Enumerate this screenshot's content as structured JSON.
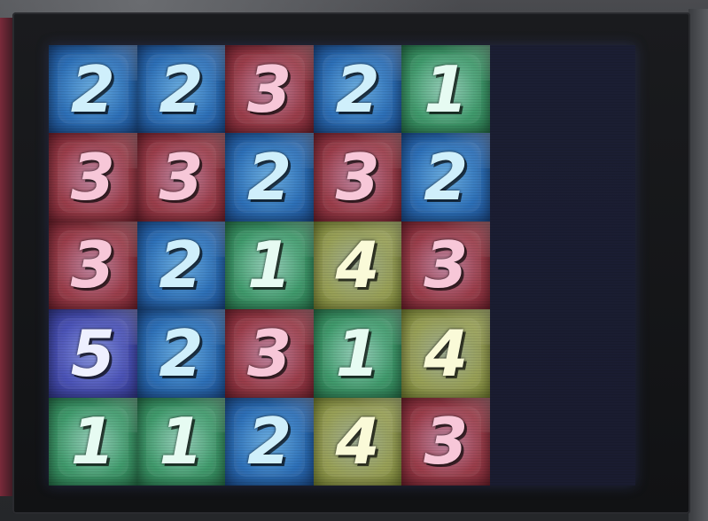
{
  "board": {
    "rows": [
      [
        {
          "value": "2",
          "color": "blue"
        },
        {
          "value": "2",
          "color": "blue"
        },
        {
          "value": "3",
          "color": "red"
        },
        {
          "value": "2",
          "color": "blue"
        },
        {
          "value": "1",
          "color": "green"
        }
      ],
      [
        {
          "value": "3",
          "color": "red"
        },
        {
          "value": "3",
          "color": "red"
        },
        {
          "value": "2",
          "color": "blue"
        },
        {
          "value": "3",
          "color": "red"
        },
        {
          "value": "2",
          "color": "blue"
        }
      ],
      [
        {
          "value": "3",
          "color": "red"
        },
        {
          "value": "2",
          "color": "blue"
        },
        {
          "value": "1",
          "color": "green"
        },
        {
          "value": "4",
          "color": "yellow"
        },
        {
          "value": "3",
          "color": "red"
        }
      ],
      [
        {
          "value": "5",
          "color": "purple"
        },
        {
          "value": "2",
          "color": "blue"
        },
        {
          "value": "3",
          "color": "red"
        },
        {
          "value": "1",
          "color": "green"
        },
        {
          "value": "4",
          "color": "yellow"
        }
      ],
      [
        {
          "value": "1",
          "color": "green"
        },
        {
          "value": "1",
          "color": "green"
        },
        {
          "value": "2",
          "color": "blue"
        },
        {
          "value": "4",
          "color": "yellow"
        },
        {
          "value": "3",
          "color": "red"
        }
      ]
    ]
  },
  "colors": {
    "blue": "#2c6fb8",
    "red": "#9c3d4a",
    "green": "#3f9b6c",
    "yellow": "#9aa257",
    "purple": "#4a52b8",
    "panel": "#1b1e33"
  }
}
